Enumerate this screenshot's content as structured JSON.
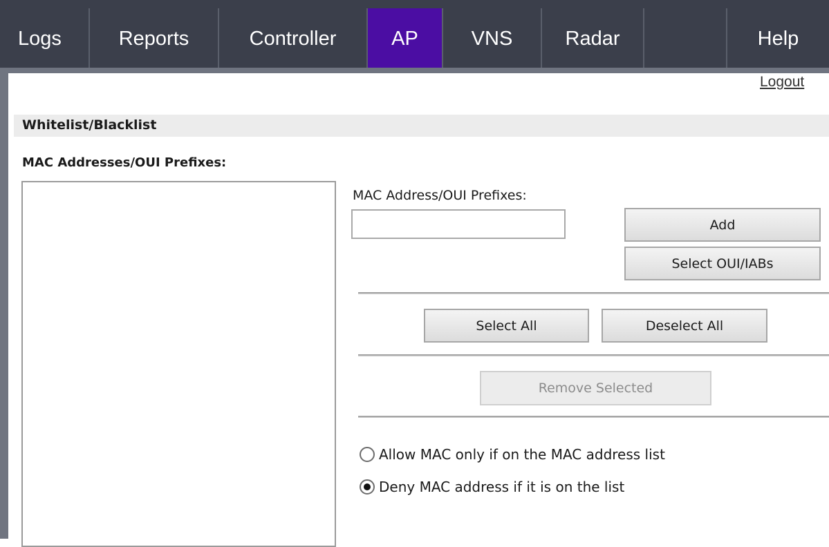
{
  "nav": {
    "tabs": [
      {
        "label": "Logs",
        "active": false
      },
      {
        "label": "Reports",
        "active": false
      },
      {
        "label": "Controller",
        "active": false
      },
      {
        "label": "AP",
        "active": true
      },
      {
        "label": "VNS",
        "active": false
      },
      {
        "label": "Radar",
        "active": false
      },
      {
        "label": "",
        "active": false
      },
      {
        "label": "Help",
        "active": false
      }
    ],
    "logout": "Logout"
  },
  "section": {
    "title": "Whitelist/Blacklist",
    "list_label": "MAC Addresses/OUI Prefixes:"
  },
  "form": {
    "field_label": "MAC Address/OUI Prefixes:",
    "input_value": "",
    "add_label": "Add",
    "select_oui_label": "Select OUI/IABs",
    "select_all_label": "Select All",
    "deselect_all_label": "Deselect All",
    "remove_selected_label": "Remove Selected"
  },
  "mode": {
    "options": [
      {
        "label": "Allow MAC only if on the MAC address list",
        "checked": false
      },
      {
        "label": "Deny MAC address if it is on the list",
        "checked": true
      }
    ]
  },
  "colors": {
    "nav_bg": "#3b3f4b",
    "active_tab": "#4b0da3"
  }
}
